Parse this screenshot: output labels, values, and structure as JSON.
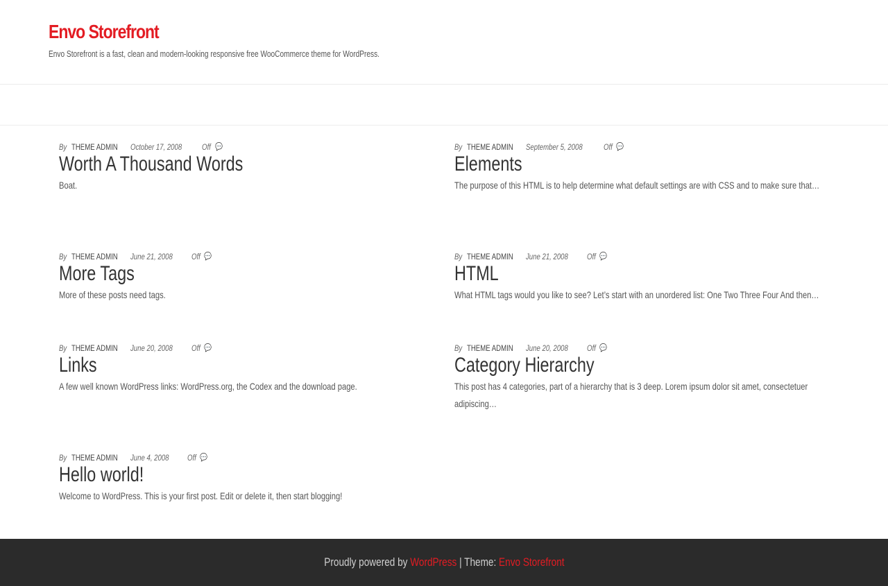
{
  "site": {
    "title": "Envo Storefront",
    "description": "Envo Storefront is a fast, clean and modern-looking responsive free WooCommerce theme for WordPress."
  },
  "posts": [
    {
      "by": "By",
      "author": "THEME ADMIN",
      "date": "October 17, 2008",
      "comments": "Off",
      "comment_icon": "comments-icon",
      "title": "Worth A Thousand Words",
      "excerpt": "Boat."
    },
    {
      "by": "By",
      "author": "THEME ADMIN",
      "date": "September 5, 2008",
      "comments": "Off",
      "comment_icon": "comments-icon",
      "title": "Elements",
      "excerpt": "The purpose of this HTML is to help determine what default settings are with CSS and to make sure that…"
    },
    {
      "by": "By",
      "author": "THEME ADMIN",
      "date": "June 21, 2008",
      "comments": "Off",
      "comment_icon": "comments-icon",
      "title": "More Tags",
      "excerpt": "More of these posts need tags."
    },
    {
      "by": "By",
      "author": "THEME ADMIN",
      "date": "June 21, 2008",
      "comments": "Off",
      "comment_icon": "comments-icon",
      "title": "HTML",
      "excerpt": "What HTML tags would you like to see? Let’s start with an unordered list: One Two Three Four And then…"
    },
    {
      "by": "By",
      "author": "THEME ADMIN",
      "date": "June 20, 2008",
      "comments": "Off",
      "comment_icon": "comments-icon",
      "title": "Links",
      "excerpt": "A few well known WordPress links: WordPress.org, the Codex and the download page."
    },
    {
      "by": "By",
      "author": "THEME ADMIN",
      "date": "June 20, 2008",
      "comments": "Off",
      "comment_icon": "comments-icon",
      "title": "Category Hierarchy",
      "excerpt": "This post has 4 categories, part of a hierarchy that is 3 deep. Lorem ipsum dolor sit amet, consectetuer adipiscing…"
    },
    {
      "by": "By",
      "author": "THEME ADMIN",
      "date": "June 4, 2008",
      "comments": "Off",
      "comment_icon": "comments-icon",
      "title": "Hello world!",
      "excerpt": "Welcome to WordPress. This is your first post. Edit or delete it, then start blogging!"
    }
  ],
  "footer": {
    "powered_prefix": "Proudly powered by",
    "wordpress_link": "WordPress",
    "separator": "|",
    "theme_prefix": "Theme:",
    "theme_link": "Envo Storefront"
  },
  "colors": {
    "accent": "#e31c23",
    "footer_bg": "#2b2b2b",
    "text": "#404040"
  }
}
